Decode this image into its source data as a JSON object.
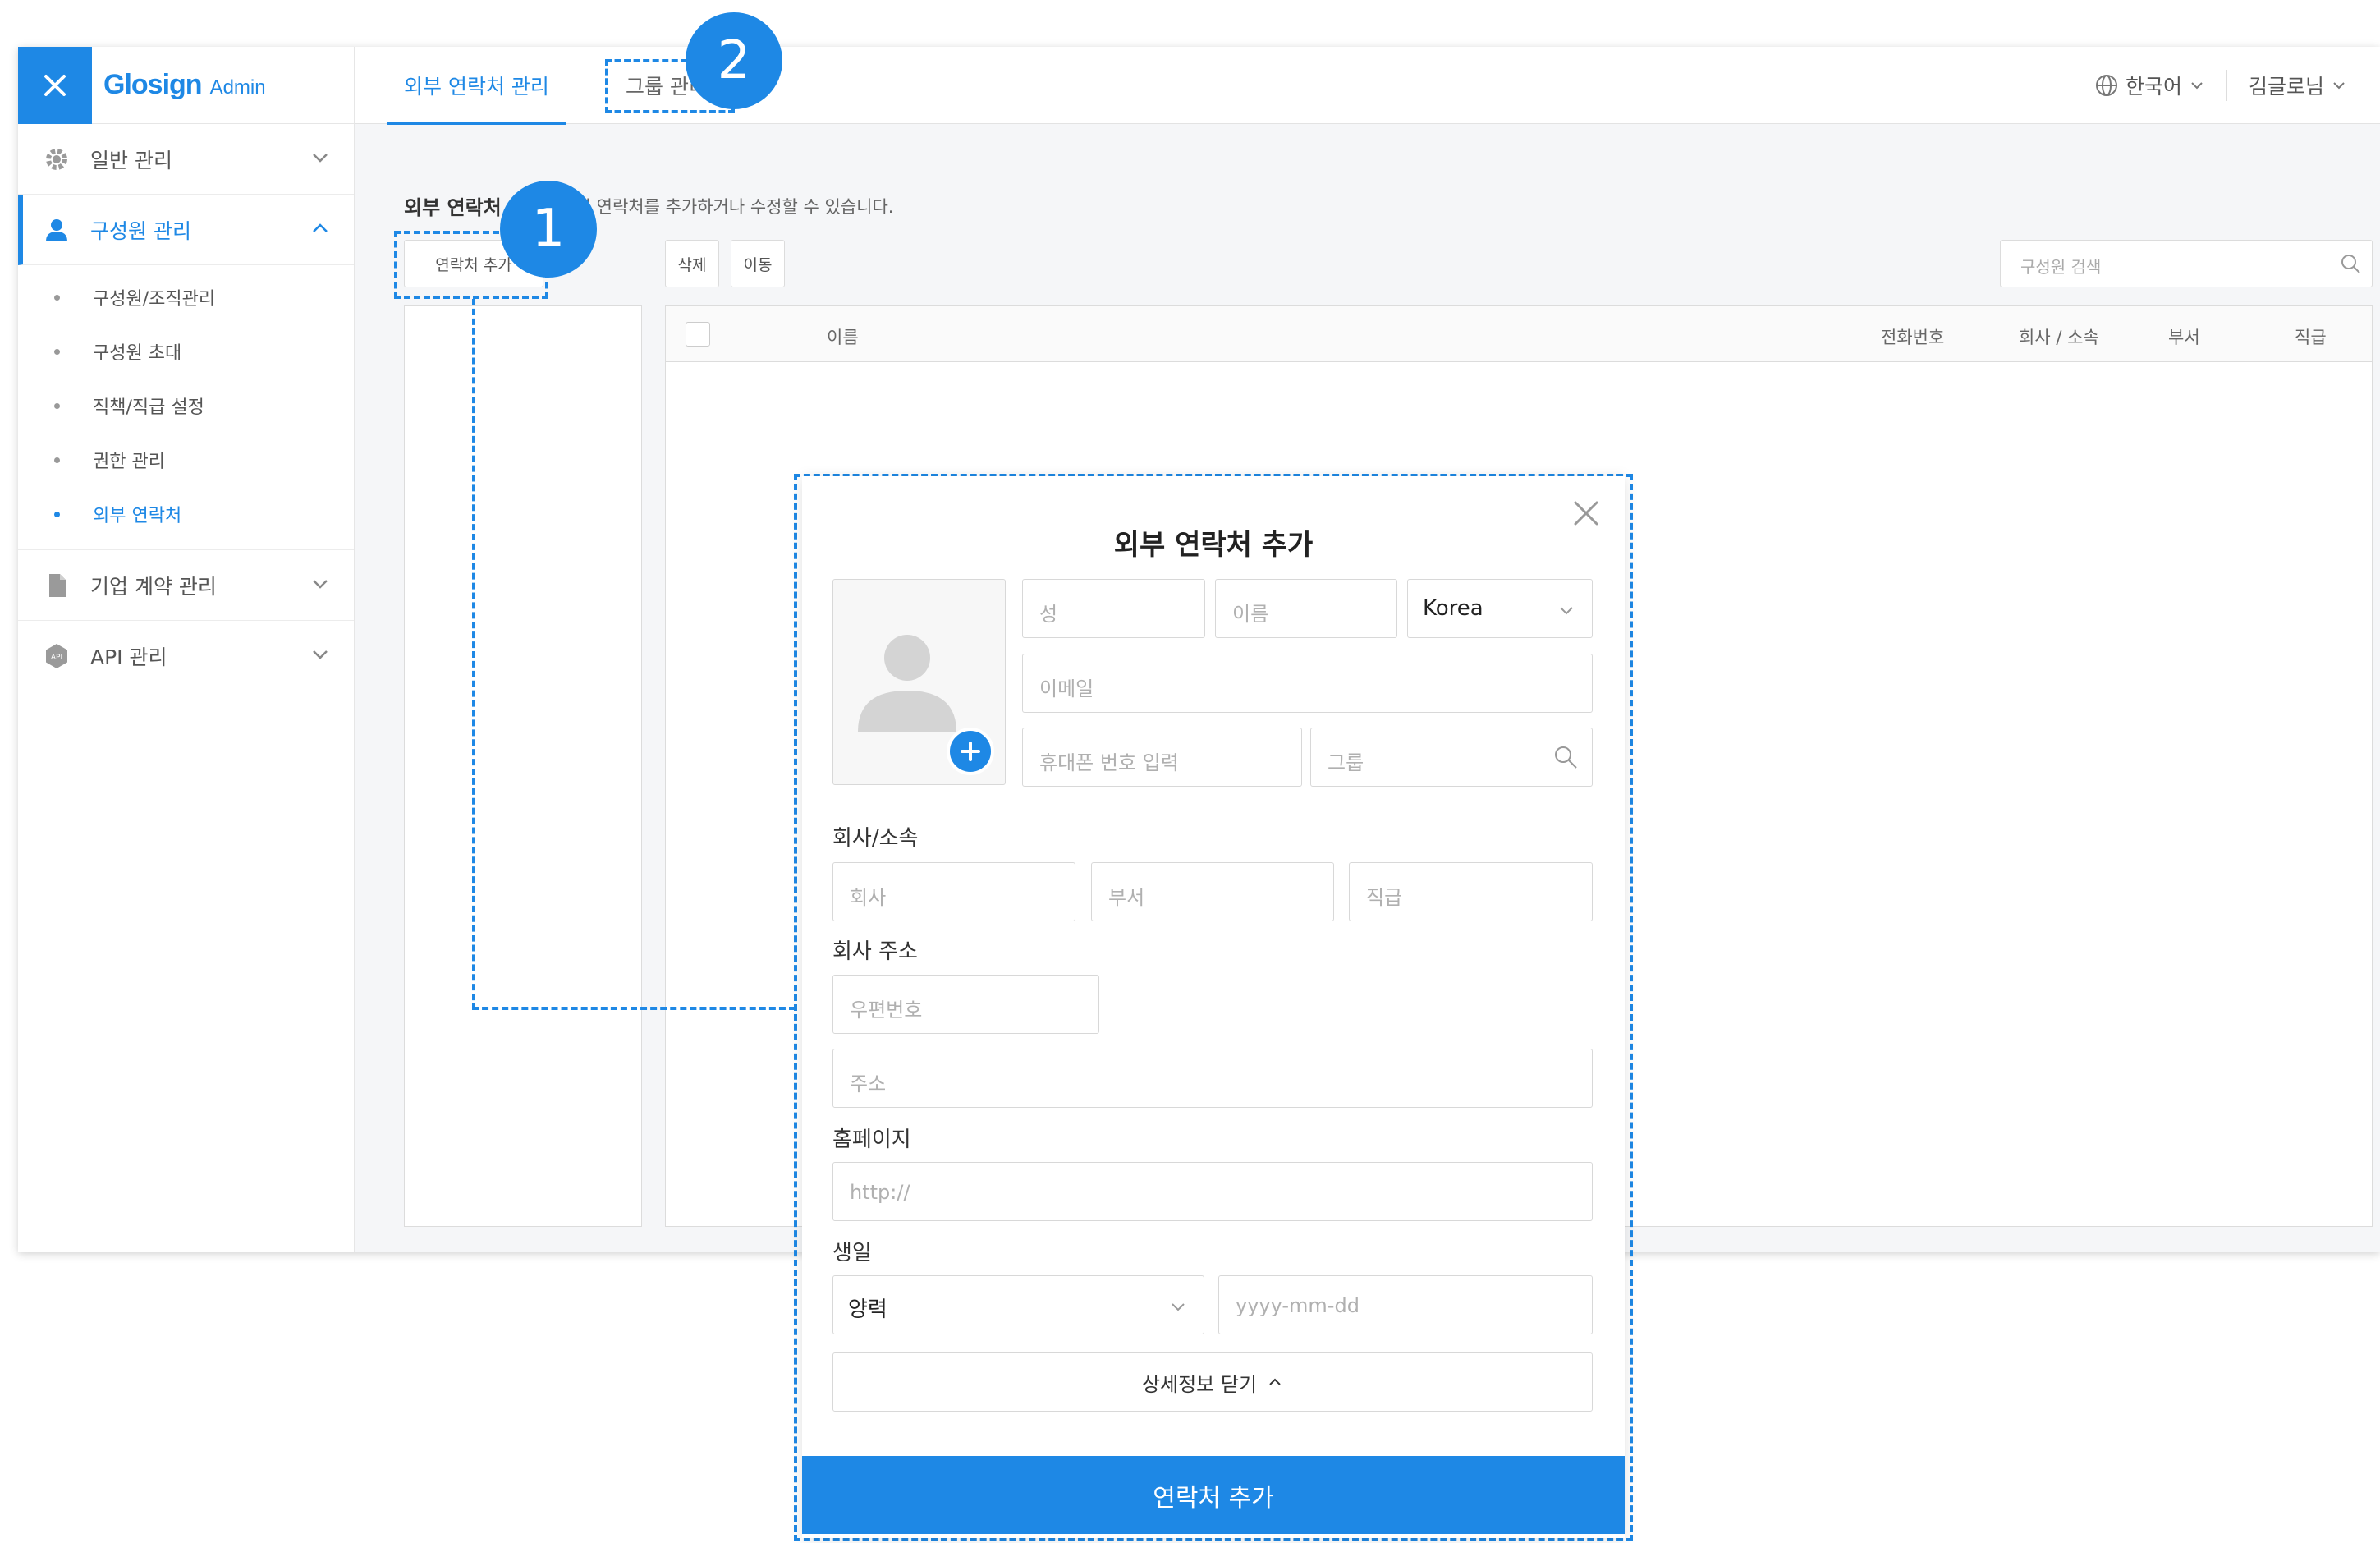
{
  "header": {
    "brand": "Glosign",
    "brand_sub": "Admin",
    "tabs": [
      {
        "label": "외부 연락처 관리"
      },
      {
        "label": "그룹 관리"
      }
    ],
    "language": "한국어",
    "user": "김글로님"
  },
  "sidebar": {
    "items": [
      {
        "label": "일반 관리",
        "icon": "gear-icon"
      },
      {
        "label": "구성원 관리",
        "icon": "person-icon"
      },
      {
        "label": "기업 계약 관리",
        "icon": "document-icon"
      },
      {
        "label": "API 관리",
        "icon": "api-icon"
      }
    ],
    "sub_items": [
      {
        "label": "구성원/조직관리"
      },
      {
        "label": "구성원 초대"
      },
      {
        "label": "직책/직급 설정"
      },
      {
        "label": "권한 관리"
      },
      {
        "label": "외부 연락처"
      }
    ]
  },
  "main": {
    "section_title": "외부 연락처",
    "section_desc": "외부의 연락처를 추가하거나 수정할 수 있습니다.",
    "add_contact_button": "연락처 추가",
    "delete_button": "삭제",
    "move_button": "이동",
    "search_placeholder": "구성원 검색",
    "columns": [
      "이름",
      "전화번호",
      "회사 / 소속",
      "부서",
      "직급"
    ]
  },
  "annotations": [
    "1",
    "2"
  ],
  "modal": {
    "title": "외부 연락처 추가",
    "last_name_placeholder": "성",
    "first_name_placeholder": "이름",
    "country": "Korea",
    "email_placeholder": "이메일",
    "phone_placeholder": "휴대폰 번호 입력",
    "group_placeholder": "그룹",
    "company_label": "회사/소속",
    "company_placeholder": "회사",
    "department_placeholder": "부서",
    "position_placeholder": "직급",
    "address_label": "회사 주소",
    "zipcode_placeholder": "우편번호",
    "address_placeholder": "주소",
    "homepage_label": "홈페이지",
    "homepage_placeholder": "http://",
    "birthday_label": "생일",
    "calendar_type": "양력",
    "birthday_placeholder": "yyyy-mm-dd",
    "toggle_details": "상세정보 닫기",
    "submit": "연락처 추가"
  },
  "colors": {
    "accent": "#1e88e5",
    "background": "#f5f6f8"
  }
}
